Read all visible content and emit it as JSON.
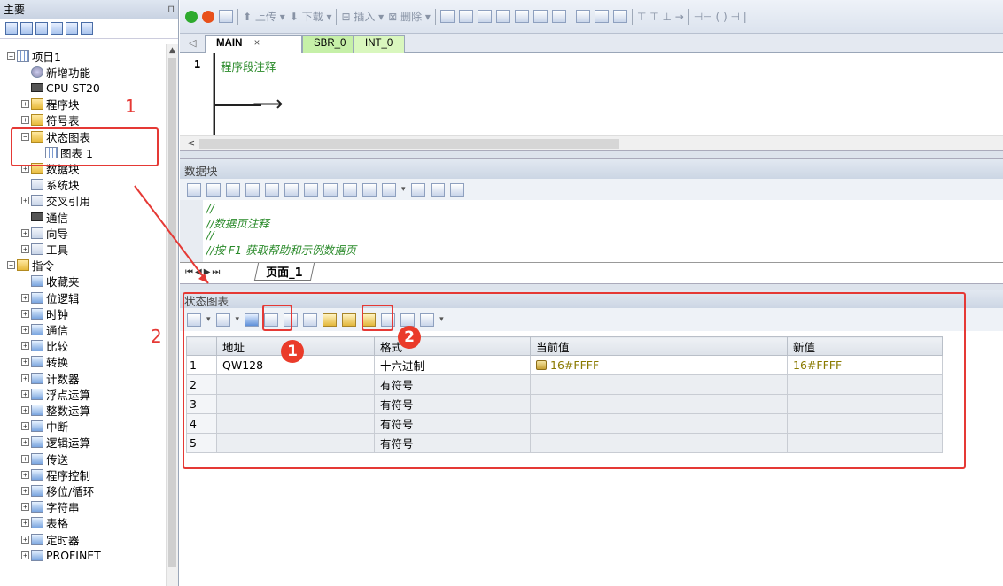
{
  "left_panel": {
    "title": "主要",
    "tree": [
      {
        "label": "项目1",
        "expander": "−"
      },
      {
        "label": "新增功能",
        "expander": ""
      },
      {
        "label": "CPU ST20",
        "expander": ""
      },
      {
        "label": "程序块",
        "expander": "+"
      },
      {
        "label": "符号表",
        "expander": "+"
      },
      {
        "label": "状态图表",
        "expander": "−"
      },
      {
        "label": "图表 1",
        "expander": ""
      },
      {
        "label": "数据块",
        "expander": "+"
      },
      {
        "label": "系统块",
        "expander": ""
      },
      {
        "label": "交叉引用",
        "expander": "+"
      },
      {
        "label": "通信",
        "expander": ""
      },
      {
        "label": "向导",
        "expander": "+"
      },
      {
        "label": "工具",
        "expander": "+"
      },
      {
        "label": "指令",
        "expander": "−"
      },
      {
        "label": "收藏夹",
        "expander": ""
      },
      {
        "label": "位逻辑",
        "expander": "+"
      },
      {
        "label": "时钟",
        "expander": "+"
      },
      {
        "label": "通信",
        "expander": "+"
      },
      {
        "label": "比较",
        "expander": "+"
      },
      {
        "label": "转换",
        "expander": "+"
      },
      {
        "label": "计数器",
        "expander": "+"
      },
      {
        "label": "浮点运算",
        "expander": "+"
      },
      {
        "label": "整数运算",
        "expander": "+"
      },
      {
        "label": "中断",
        "expander": "+"
      },
      {
        "label": "逻辑运算",
        "expander": "+"
      },
      {
        "label": "传送",
        "expander": "+"
      },
      {
        "label": "程序控制",
        "expander": "+"
      },
      {
        "label": "移位/循环",
        "expander": "+"
      },
      {
        "label": "字符串",
        "expander": "+"
      },
      {
        "label": "表格",
        "expander": "+"
      },
      {
        "label": "定时器",
        "expander": "+"
      },
      {
        "label": "PROFINET",
        "expander": "+"
      }
    ]
  },
  "annotations": {
    "label_1": "1",
    "label_2": "2",
    "circle_1": "1",
    "circle_2": "2",
    "color": "#e53935"
  },
  "toolbar": {
    "upload": "上传",
    "download": "下载",
    "insert": "插入",
    "delete": "删除"
  },
  "editor": {
    "tabs": [
      {
        "label": "MAIN",
        "close": "×"
      },
      {
        "label": "SBR_0"
      },
      {
        "label": "INT_0"
      }
    ],
    "line_number": "1",
    "comment": "程序段注释"
  },
  "data_block": {
    "title": "数据块",
    "lines": [
      "//",
      "//数据页注释",
      "//",
      "//按 F1 获取帮助和示例数据页"
    ],
    "page_tab": "页面_1"
  },
  "status_chart": {
    "title": "状态图表",
    "columns": [
      "",
      "地址",
      "格式",
      "当前值",
      "新值"
    ],
    "rows": [
      {
        "index": "1",
        "address": "QW128",
        "format": "十六进制",
        "current": "16#FFFF",
        "new": "16#FFFF"
      },
      {
        "index": "2",
        "address": "",
        "format": "有符号",
        "current": "",
        "new": ""
      },
      {
        "index": "3",
        "address": "",
        "format": "有符号",
        "current": "",
        "new": ""
      },
      {
        "index": "4",
        "address": "",
        "format": "有符号",
        "current": "",
        "new": ""
      },
      {
        "index": "5",
        "address": "",
        "format": "有符号",
        "current": "",
        "new": ""
      }
    ]
  }
}
